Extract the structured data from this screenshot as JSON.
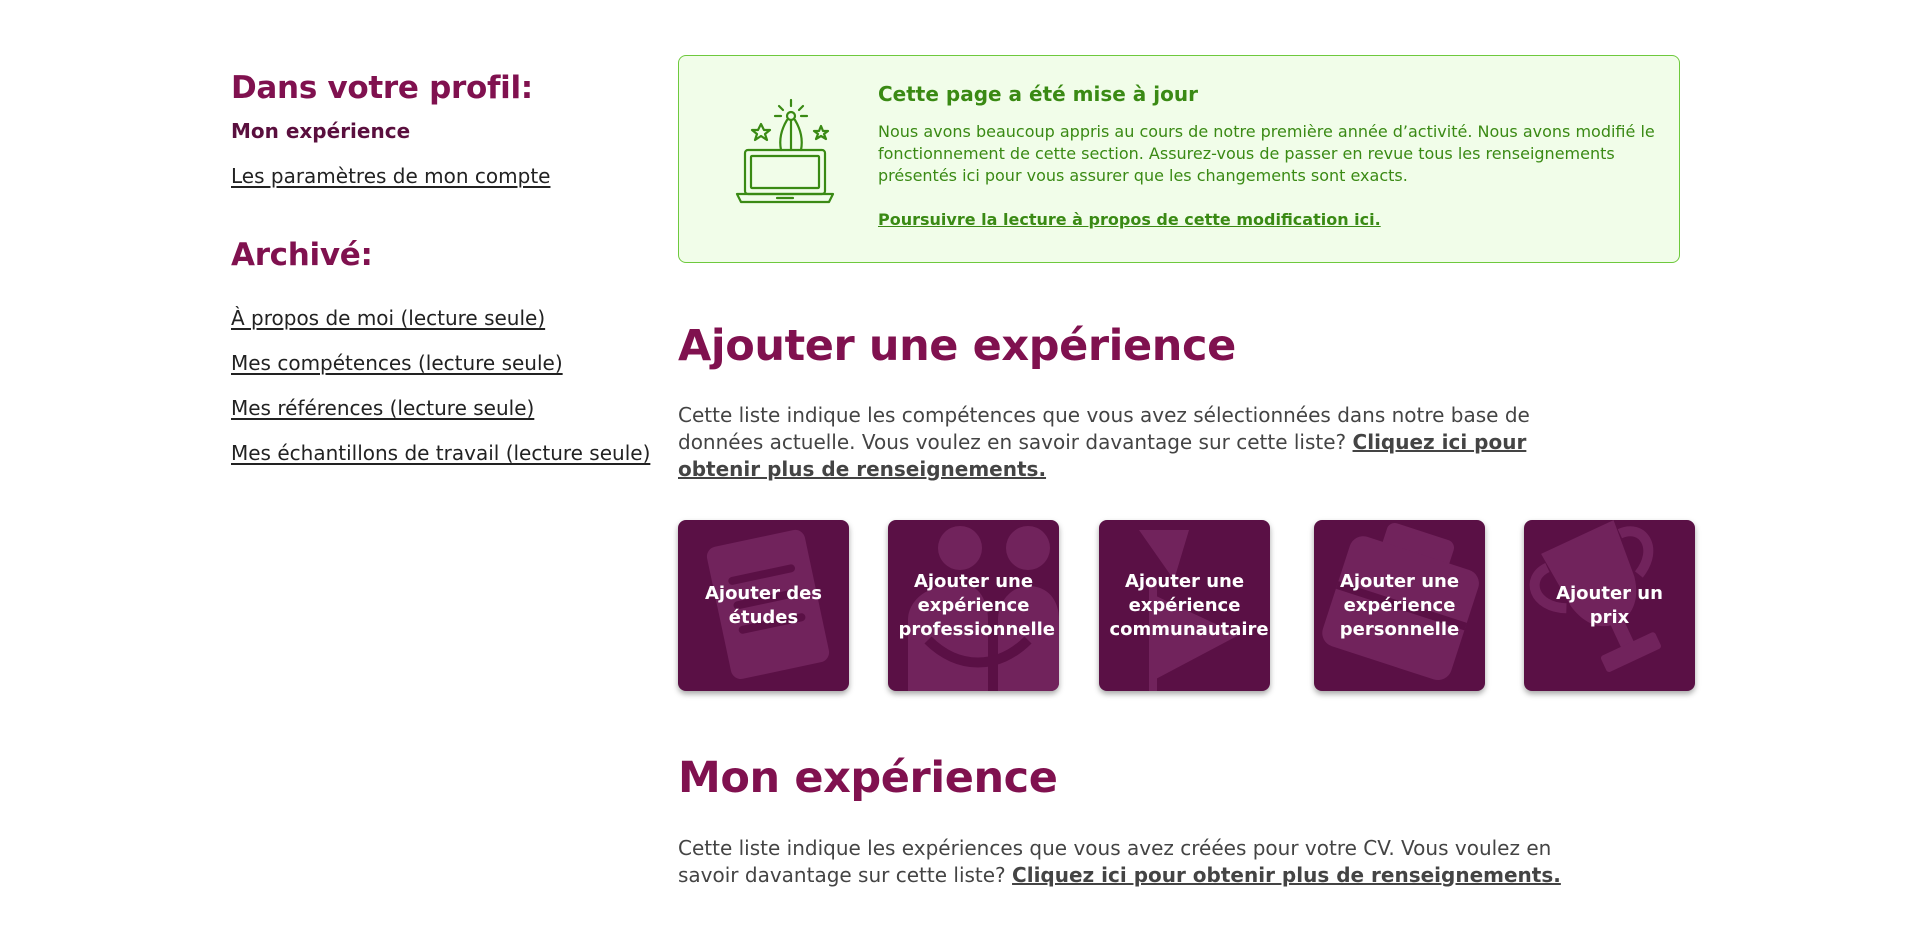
{
  "sidebar": {
    "profile_heading": "Dans votre profil:",
    "current_item": "Mon expérience",
    "account_link": "Les paramètres de mon compte",
    "archive_heading": "Archivé:",
    "archive_links": [
      "À propos de moi (lecture seule)",
      "Mes compétences (lecture seule)",
      "Mes références (lecture seule)",
      "Mes échantillons de travail (lecture seule)"
    ]
  },
  "notice": {
    "icon": "laptop-fireworks-icon",
    "title": "Cette page a été mise à jour",
    "body": "Nous avons beaucoup appris au cours de notre première année d’activité. Nous avons modifié le fonctionnement de cette section. Assurez-vous de passer en revue tous les renseignements présentés ici pour vous assurer que les changements sont exacts.",
    "link": "Poursuivre la lecture à propos de cette modification ici."
  },
  "add_experience": {
    "title": "Ajouter une expérience",
    "text": "Cette liste indique les compétences que vous avez sélectionnées dans notre base de données actuelle. Vous voulez en savoir davantage sur cette liste? ",
    "link": "Cliquez ici pour obtenir plus de renseignements.",
    "tiles": [
      {
        "label": "Ajouter des études",
        "icon": "diploma-icon"
      },
      {
        "label": "Ajouter une expérience professionnelle",
        "icon": "people-icon"
      },
      {
        "label": "Ajouter une expérience communautaire",
        "icon": "flag-icon"
      },
      {
        "label": "Ajouter une expérience personnelle",
        "icon": "briefcase-icon"
      },
      {
        "label": "Ajouter un prix",
        "icon": "trophy-icon"
      }
    ]
  },
  "my_experience": {
    "title": "Mon expérience",
    "text": "Cette liste indique les expériences que vous avez créées pour votre CV. Vous voulez en savoir davantage sur cette liste? ",
    "link": "Cliquez ici pour obtenir plus de renseignements."
  },
  "colors": {
    "brand": "#80114f",
    "tile": "#5a1045",
    "notice_bg": "#f1fde9",
    "notice_text": "#3a8a14"
  }
}
